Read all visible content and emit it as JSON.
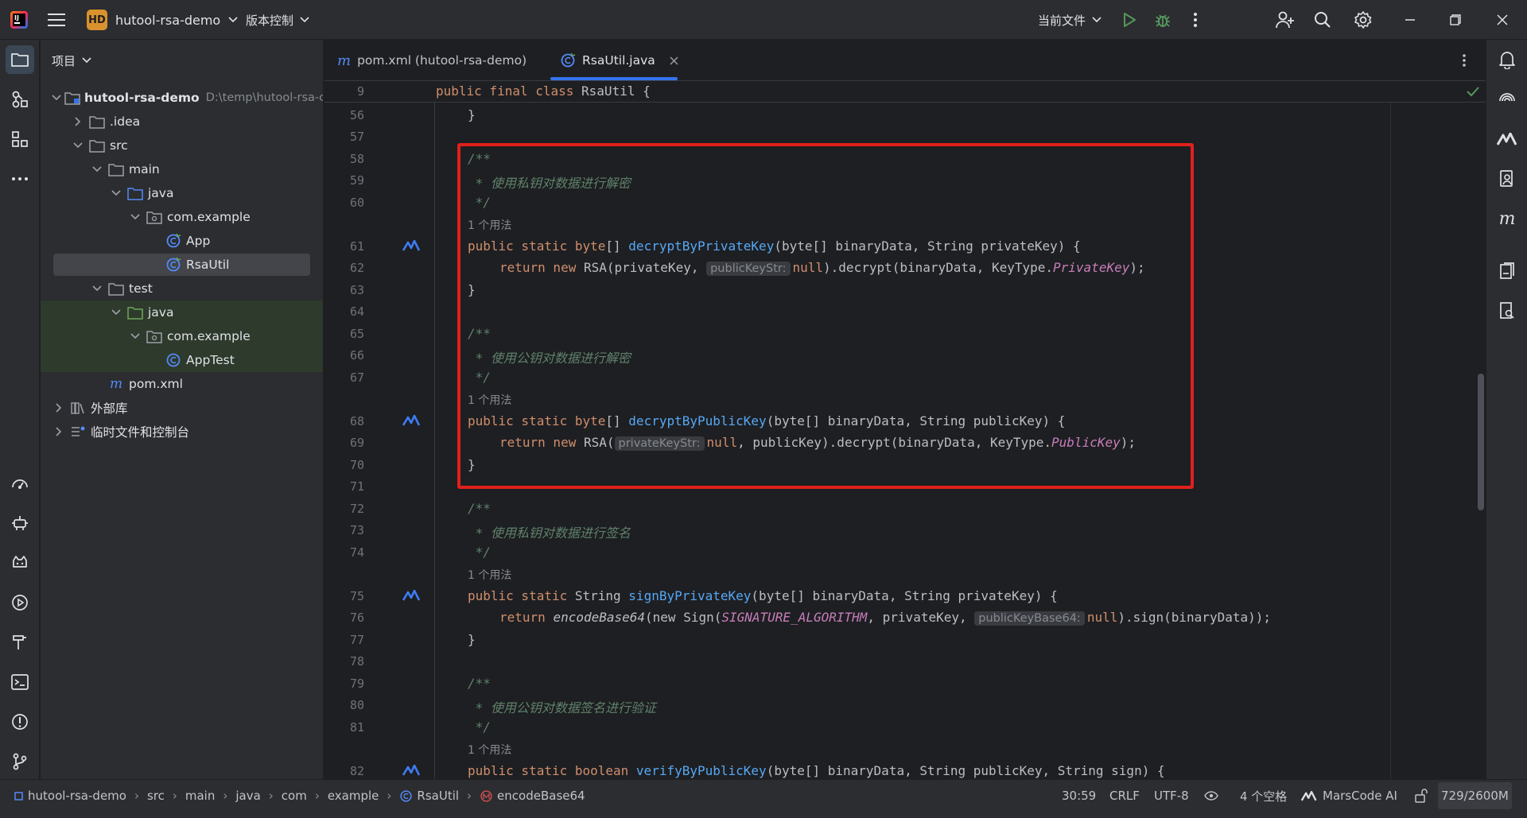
{
  "titlebar": {
    "project_badge": "HD",
    "project_name": "hutool-rsa-demo",
    "vcs_label": "版本控制",
    "run_config": "当前文件"
  },
  "project_panel": {
    "header": "项目",
    "root_name": "hutool-rsa-demo",
    "root_path": "D:\\temp\\hutool-rsa-c",
    "items": {
      "idea": ".idea",
      "src": "src",
      "main": "main",
      "java_main": "java",
      "pkg_main": "com.example",
      "app": "App",
      "rsautil": "RsaUtil",
      "test": "test",
      "java_test": "java",
      "pkg_test": "com.example",
      "apptest": "AppTest",
      "pom": "pom.xml",
      "external": "外部库",
      "scratches": "临时文件和控制台"
    }
  },
  "tabs": {
    "pom": "pom.xml (hutool-rsa-demo)",
    "rsautil": "RsaUtil.java"
  },
  "editor": {
    "usage_label": "1 个用法",
    "sticky": {
      "line": "9",
      "t1": "public final class ",
      "t2": "RsaUtil {"
    },
    "line_numbers": [
      "56",
      "57",
      "58",
      "59",
      "60",
      "61",
      "62",
      "63",
      "64",
      "65",
      "66",
      "67",
      "68",
      "69",
      "70",
      "71",
      "72",
      "73",
      "74",
      "75",
      "76",
      "77",
      "78",
      "79",
      "80",
      "81",
      "82"
    ],
    "code": {
      "l56": "}",
      "c_open": "/**",
      "c_close": " */",
      "c_star": " * ",
      "c58_text": "使用私钥对数据进行解密",
      "c65_text": "使用公钥对数据进行解密",
      "c72_text": "使用私钥对数据进行签名",
      "c79_text": "使用公钥对数据签名进行验证",
      "public_static": "public static ",
      "byte_arr": "byte",
      "brk": "[] ",
      "fn_decPriv": "decryptByPrivateKey",
      "sig_decPriv": "(byte[] binaryData, String privateKey) {",
      "fn_decPub": "decryptByPublicKey",
      "sig_decPub": "(byte[] binaryData, String publicKey) {",
      "return_new": "return new ",
      "rsa_open": "RSA(",
      "l62_a": "privateKey, ",
      "hint_pubKeyStr": "publicKeyStr:",
      "null": "null",
      "l62_b": ").decrypt(binaryData, KeyType.",
      "PrivateKey": "PrivateKey",
      "end_paren": ");",
      "close_brace": "}",
      "hint_privKeyStr": "privateKeyStr:",
      "l69_b": ", publicKey).decrypt(binaryData, KeyType.",
      "PublicKey": "PublicKey",
      "string_t": "String ",
      "fn_signPriv": "signByPrivateKey",
      "sig_signPriv": "(byte[] binaryData, String privateKey) {",
      "return_kw": "return ",
      "encodeBase64": "encodeBase64",
      "new_sign": "(new Sign(",
      "SIG_ALG": "SIGNATURE_ALGORITHM",
      "l76_a": ", privateKey, ",
      "hint_pubKeyB64": "publicKeyBase64:",
      "l76_b": ").sign(binaryData));",
      "boolean_t": "boolean ",
      "fn_verifyPub": "verifyByPublicKey",
      "sig_verifyPub": "(byte[] binaryData, String publicKey, String sign) {"
    }
  },
  "statusbar": {
    "crumbs": [
      "hutool-rsa-demo",
      "src",
      "main",
      "java",
      "com",
      "example",
      "RsaUtil",
      "encodeBase64"
    ],
    "position": "30:59",
    "line_sep": "CRLF",
    "encoding": "UTF-8",
    "indent": "4 个空格",
    "ai": "MarsCode AI",
    "memory": "729/2600M"
  },
  "colors": {
    "accent": "#3574f0",
    "highlight_box": "#e0201c",
    "badge": "#d9922e"
  }
}
